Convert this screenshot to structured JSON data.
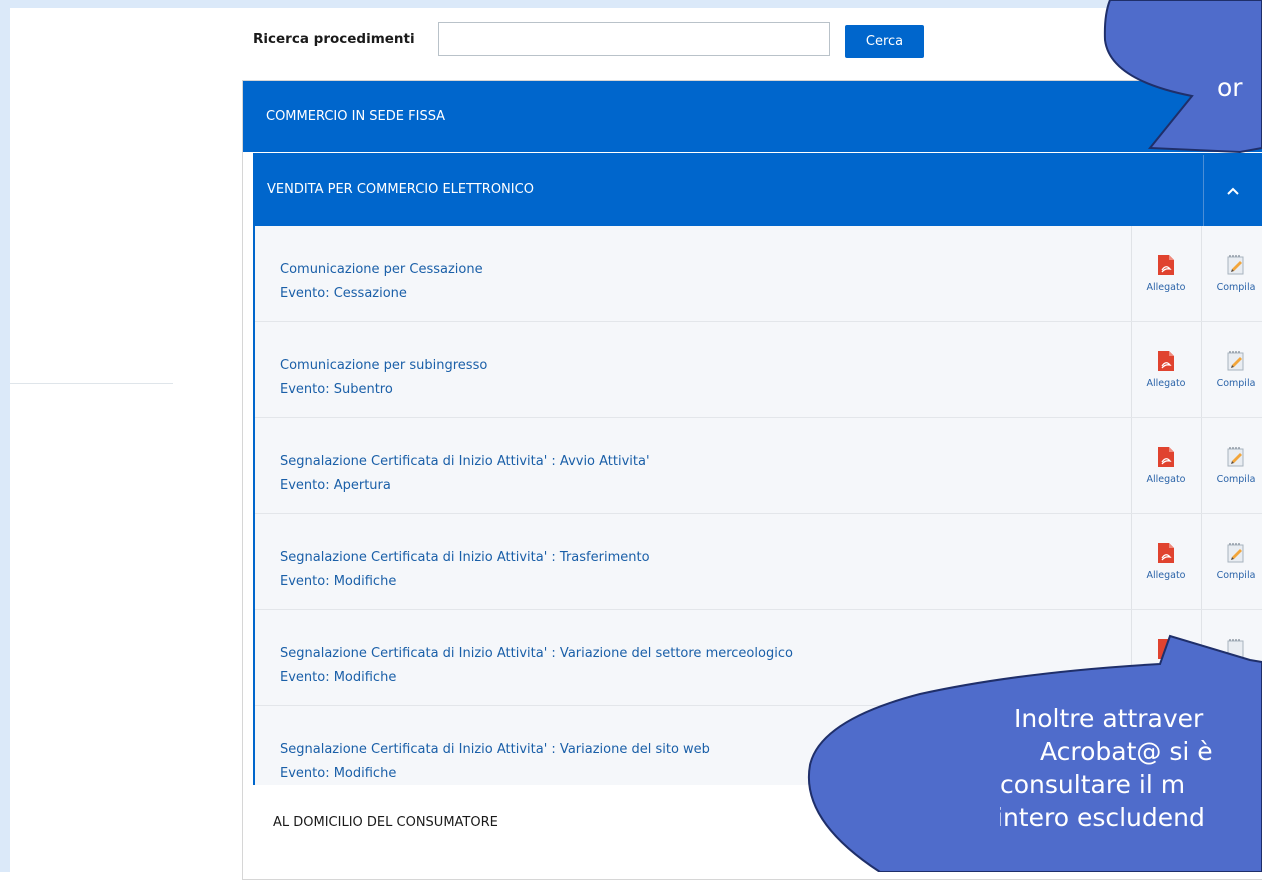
{
  "search": {
    "label": "Ricerca procedimenti",
    "value": "",
    "placeholder": "",
    "button_label": "Cerca"
  },
  "panel": {
    "title": "COMMERCIO IN SEDE FISSA"
  },
  "subpanel": {
    "title": "VENDITA PER COMMERCIO ELETTRONICO"
  },
  "rows": [
    {
      "title": "Comunicazione per Cessazione",
      "event": "Evento: Cessazione",
      "allegato": "Allegato",
      "compila": "Compila"
    },
    {
      "title": "Comunicazione per subingresso",
      "event": "Evento: Subentro",
      "allegato": "Allegato",
      "compila": "Compila"
    },
    {
      "title": "Segnalazione Certificata di Inizio Attivita' : Avvio Attivita'",
      "event": "Evento: Apertura",
      "allegato": "Allegato",
      "compila": "Compila"
    },
    {
      "title": "Segnalazione Certificata di Inizio Attivita' : Trasferimento",
      "event": "Evento: Modifiche",
      "allegato": "Allegato",
      "compila": "Compila"
    },
    {
      "title": "Segnalazione Certificata di Inizio Attivita' : Variazione del settore merceologico",
      "event": "Evento: Modifiche"
    },
    {
      "title": "Segnalazione Certificata di Inizio Attivita' : Variazione del sito web",
      "event": "Evento: Modifiche"
    }
  ],
  "next_section": {
    "title": "AL DOMICILIO DEL CONSUMATORE"
  },
  "callouts": {
    "top_text": "or",
    "bottom_lines": [
      "Inoltre attraver",
      "Acrobat@ si è",
      "consultare  il m",
      "intero escludend"
    ]
  },
  "colors": {
    "primary": "#0066cc",
    "callout_fill": "#4f6ccb",
    "callout_stroke": "#1f2f6a",
    "frame": "#dbe9f9"
  }
}
